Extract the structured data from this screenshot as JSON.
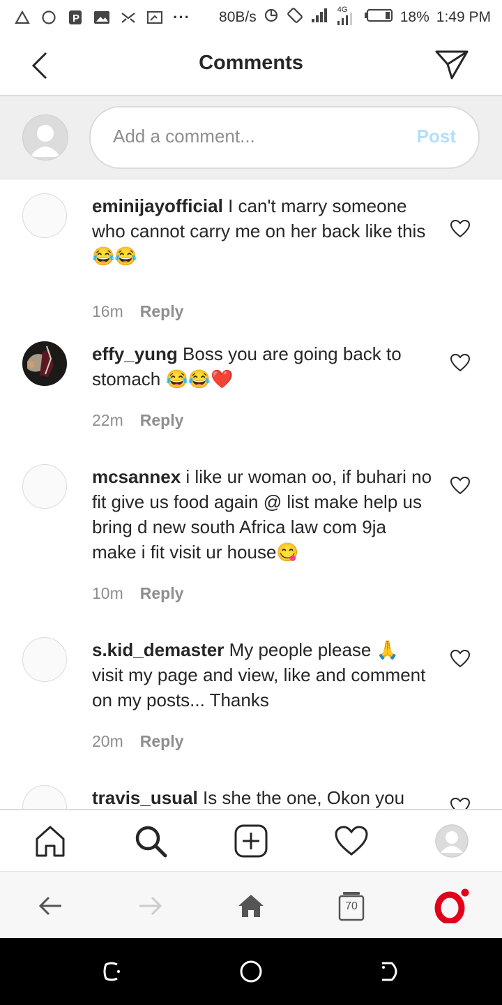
{
  "status_bar": {
    "speed": "80B/s",
    "network": "4G",
    "battery": "18%",
    "time": "1:49 PM",
    "more": "···"
  },
  "header": {
    "title": "Comments"
  },
  "comment_box": {
    "placeholder": "Add a comment...",
    "post_label": "Post"
  },
  "comments": [
    {
      "user": "eminijayofficial",
      "text": "I can't marry someone who cannot carry me on her back like this😂😂",
      "time": "16m",
      "reply": "Reply"
    },
    {
      "user": "effy_yung",
      "text": "Boss you are going back to stomach 😂😂❤️",
      "time": "22m",
      "reply": "Reply"
    },
    {
      "user": "mcsannex",
      "text": "i like ur woman oo, if buhari no fit give us food again @ list make help us bring d new south Africa law com 9ja make i fit visit ur house😋",
      "time": "10m",
      "reply": "Reply"
    },
    {
      "user": "s.kid_demaster",
      "text": "My people please 🙏 visit my page and view, like and comment on my posts... Thanks",
      "time": "20m",
      "reply": "Reply"
    },
    {
      "user": "travis_usual",
      "text": "Is she the one, Okon you",
      "time": "",
      "reply": ""
    }
  ],
  "browser_bar": {
    "tabs_count": "70"
  },
  "colors": {
    "post_disabled": "#b2dffc",
    "opera_red": "#e0001b",
    "muted": "#8e8e8e"
  }
}
